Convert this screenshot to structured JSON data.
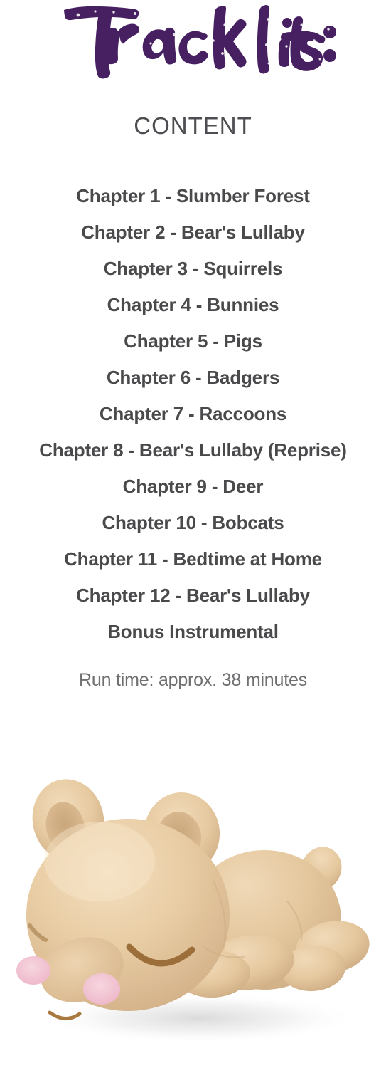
{
  "page": {
    "background_color": "#ffffff"
  },
  "header": {
    "title": "Tracklist:",
    "title_color": "#472061",
    "section_heading": "CONTENT",
    "section_heading_color": "#4e4e52"
  },
  "tracklist": {
    "text_color": "#4a4a4c",
    "items": [
      {
        "label": "Chapter 1 - Slumber Forest"
      },
      {
        "label": "Chapter 2 - Bear's Lullaby"
      },
      {
        "label": "Chapter 3 - Squirrels"
      },
      {
        "label": "Chapter 4 - Bunnies"
      },
      {
        "label": "Chapter 5 - Pigs"
      },
      {
        "label": "Chapter 6 - Badgers"
      },
      {
        "label": "Chapter 7 - Raccoons"
      },
      {
        "label": "Chapter 8 - Bear's Lullaby (Reprise)"
      },
      {
        "label": "Chapter 9 - Deer"
      },
      {
        "label": "Chapter 10 - Bobcats"
      },
      {
        "label": "Chapter 11 - Bedtime at Home"
      },
      {
        "label": "Chapter 12 - Bear's Lullaby"
      },
      {
        "label": "Bonus Instrumental"
      }
    ]
  },
  "footer": {
    "runtime": "Run time: approx. 38 minutes",
    "runtime_color": "#6f6f72"
  },
  "product_image": {
    "name": "sleeping-bear-figurine",
    "body_color": "#e7caa0",
    "body_highlight_color": "#f2dcbb",
    "body_shade_color": "#d3b187",
    "cheek_color": "#f0c4d2",
    "eye_color": "#9c6f3a",
    "shadow_color": "#dcdcdc"
  }
}
